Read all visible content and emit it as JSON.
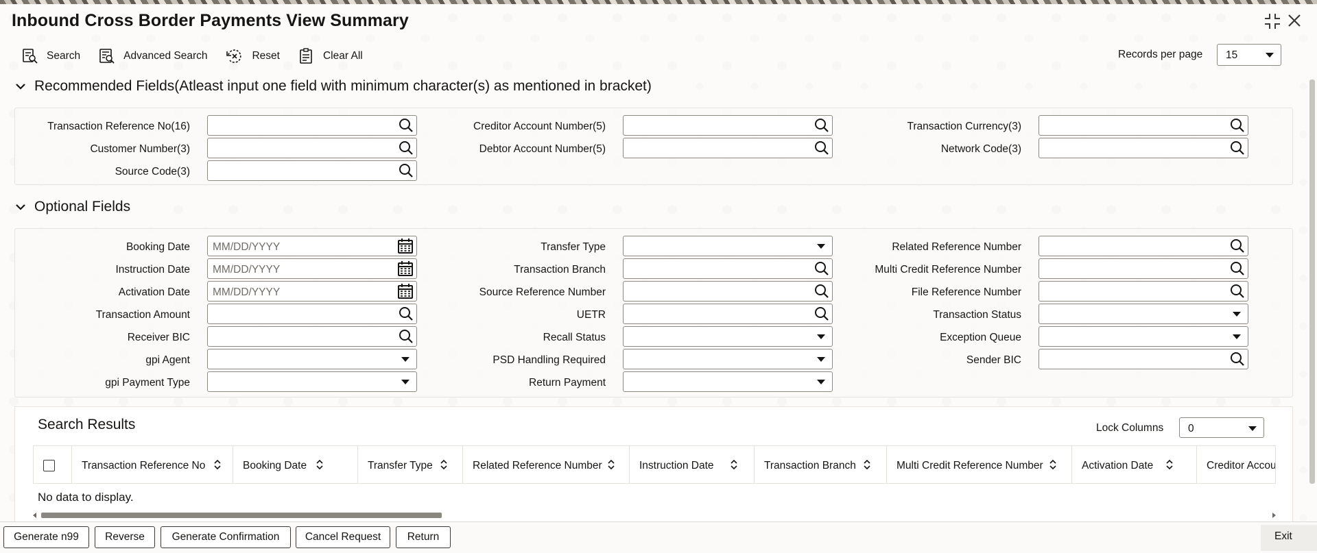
{
  "window": {
    "title": "Inbound Cross Border Payments View Summary"
  },
  "toolbar": {
    "search": "Search",
    "advanced_search": "Advanced Search",
    "reset": "Reset",
    "clear_all": "Clear All",
    "records_per_page_label": "Records per page",
    "records_per_page_value": "15"
  },
  "recommended": {
    "title": "Recommended Fields(Atleast input one field with minimum character(s) as mentioned in bracket)",
    "fields": {
      "txn_ref": "Transaction Reference No(16)",
      "creditor_acc": "Creditor Account Number(5)",
      "txn_currency": "Transaction Currency(3)",
      "customer_no": "Customer Number(3)",
      "debtor_acc": "Debtor Account Number(5)",
      "network_code": "Network Code(3)",
      "source_code": "Source Code(3)"
    }
  },
  "optional": {
    "title": "Optional Fields",
    "date_placeholder": "MM/DD/YYYY",
    "fields": {
      "booking_date": "Booking Date",
      "transfer_type": "Transfer Type",
      "related_ref": "Related Reference Number",
      "instruction_date": "Instruction Date",
      "txn_branch": "Transaction Branch",
      "multi_credit_ref": "Multi Credit Reference Number",
      "activation_date": "Activation Date",
      "source_ref": "Source Reference Number",
      "file_ref": "File Reference Number",
      "txn_amount": "Transaction Amount",
      "uetr": "UETR",
      "txn_status": "Transaction Status",
      "receiver_bic": "Receiver BIC",
      "recall_status": "Recall Status",
      "exception_queue": "Exception Queue",
      "gpi_agent": "gpi Agent",
      "psd_handling": "PSD Handling Required",
      "sender_bic": "Sender BIC",
      "gpi_payment_type": "gpi Payment Type",
      "return_payment": "Return Payment"
    }
  },
  "results": {
    "title": "Search Results",
    "lock_columns_label": "Lock Columns",
    "lock_columns_value": "0",
    "columns": [
      "Transaction Reference No",
      "Booking Date",
      "Transfer Type",
      "Related Reference Number",
      "Instruction Date",
      "Transaction Branch",
      "Multi Credit Reference Number",
      "Activation Date",
      "Creditor Account"
    ],
    "empty_message": "No data to display."
  },
  "footer": {
    "generate_n99": "Generate n99",
    "reverse": "Reverse",
    "generate_confirmation": "Generate Confirmation",
    "cancel_request": "Cancel Request",
    "return": "Return",
    "exit": "Exit"
  }
}
